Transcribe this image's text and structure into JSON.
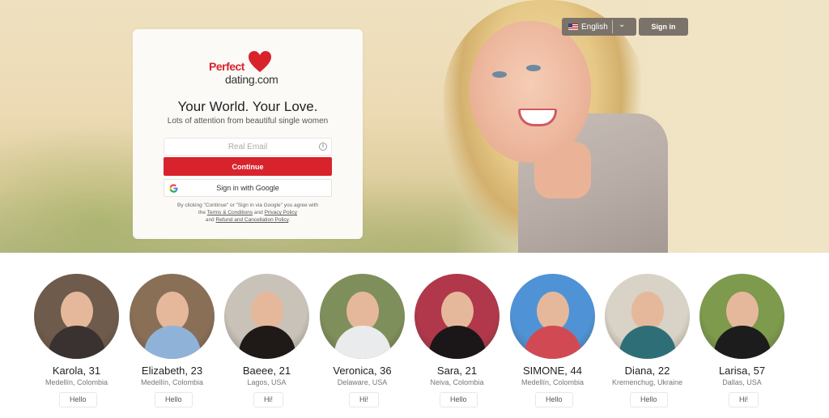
{
  "header": {
    "language": "English",
    "signin_label": "Sign in"
  },
  "card": {
    "logo_top": "Perfect",
    "logo_bottom": "dating.com",
    "title": "Your World. Your Love.",
    "subtitle": "Lots of attention from beautiful single women",
    "email_placeholder": "Real Email",
    "continue_label": "Continue",
    "google_label": "Sign in with Google",
    "legal_line1": "By clicking \"Continue\" or \"Sign in via Google\" you agree with",
    "legal_the": "the",
    "legal_terms": "Terms & Conditions",
    "legal_and": "and",
    "legal_privacy": "Privacy Policy",
    "legal_and2": "and",
    "legal_refund": "Refund and Cancellation Policy",
    "legal_end": "."
  },
  "colors": {
    "brand_red": "#d8232d",
    "button_dark": "#7b736a"
  },
  "profiles": [
    {
      "name": "Karola, 31",
      "location": "Medellín, Colombia",
      "greeting": "Hello",
      "bg": "#6f5b4b",
      "body": "#3a3230"
    },
    {
      "name": "Elizabeth, 23",
      "location": "Medellín, Colombia",
      "greeting": "Hello",
      "bg": "#8a6f57",
      "body": "#8fb3d8"
    },
    {
      "name": "Baeee, 21",
      "location": "Lagos, USA",
      "greeting": "Hi!",
      "bg": "#c9c2b8",
      "body": "#1f1a18"
    },
    {
      "name": "Veronica, 36",
      "location": "Delaware, USA",
      "greeting": "Hi!",
      "bg": "#7f8f5c",
      "body": "#e9ebec"
    },
    {
      "name": "Sara, 21",
      "location": "Neiva, Colombia",
      "greeting": "Hello",
      "bg": "#b0384a",
      "body": "#1b1718"
    },
    {
      "name": "SIMONE, 44",
      "location": "Medellín, Colombia",
      "greeting": "Hello",
      "bg": "#4f93d6",
      "body": "#d14a53"
    },
    {
      "name": "Diana, 22",
      "location": "Kremenchug, Ukraine",
      "greeting": "Hello",
      "bg": "#d9d2c6",
      "body": "#2e6f77"
    },
    {
      "name": "Larisa, 57",
      "location": "Dallas, USA",
      "greeting": "Hi!",
      "bg": "#7d9a4d",
      "body": "#1c1c1c"
    }
  ]
}
